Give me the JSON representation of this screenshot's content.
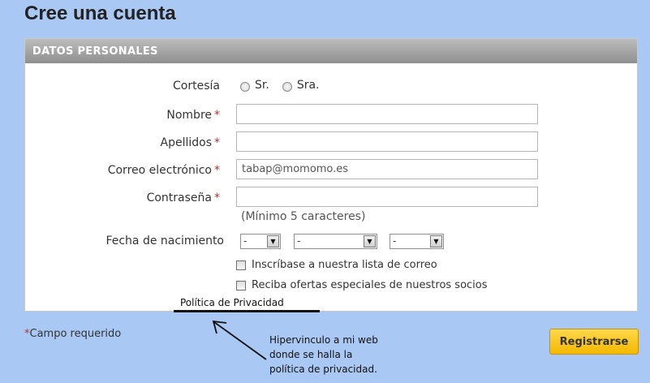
{
  "page_title": "Cree una cuenta",
  "section": {
    "header": "DATOS PERSONALES"
  },
  "form": {
    "cortesia": {
      "label": "Cortesía",
      "options": [
        "Sr.",
        "Sra."
      ]
    },
    "nombre": {
      "label": "Nombre",
      "value": ""
    },
    "apellidos": {
      "label": "Apellidos",
      "value": ""
    },
    "correo": {
      "label": "Correo electrónico",
      "value": "tabap@momomo.es"
    },
    "contrasena": {
      "label": "Contraseña",
      "value": "",
      "hint": "(Mínimo 5 caracteres)"
    },
    "fecha": {
      "label": "Fecha de nacimiento",
      "day": "-",
      "month": "-",
      "year": "-"
    },
    "newsletter_label": "Inscríbase a nuestra lista de correo",
    "offers_label": "Reciba ofertas especiales de nuestros socios",
    "required_marker": "*"
  },
  "privacy_link": "Política de Privacidad",
  "required_note": {
    "star": "*",
    "text": "Campo requerido"
  },
  "register_button": "Registrarse",
  "annotation": [
    "Hipervinculo a mi web",
    "donde se halla la",
    "política de privacidad."
  ],
  "colors": {
    "background": "#a9c8f4",
    "button": "#f4b800",
    "required": "#dd2222"
  }
}
